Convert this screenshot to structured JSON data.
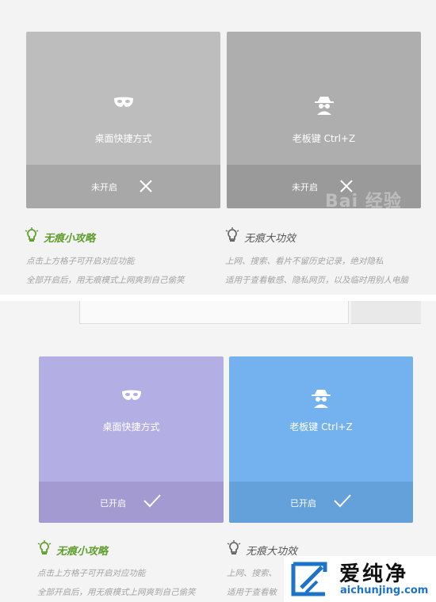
{
  "screen_top": {
    "cards": [
      {
        "id": "desktop",
        "title": "桌面快捷方式",
        "status": "未开启",
        "icon": "mask-icon",
        "action_icon": "close-icon",
        "face_color": "#bdbdbd",
        "foot_color": "#a8a8a8"
      },
      {
        "id": "boss",
        "title": "老板键 Ctrl+Z",
        "status": "未开启",
        "icon": "incognito-person-icon",
        "action_icon": "close-icon",
        "face_color": "#aeaeae",
        "foot_color": "#9a9a9a"
      }
    ],
    "tips_left": {
      "heading": "无痕小攻略",
      "lines": [
        "点击上方格子可开启对应功能",
        "全部开启后，用无痕模式上网爽到自己偷笑"
      ],
      "color": "#5e9e2a"
    },
    "tips_right": {
      "heading": "无痕大功效",
      "lines": [
        "上网、搜索、看片不留历史记录，绝对隐私",
        "适用于查看敏感、隐私网页，以及临时用别人电脑"
      ],
      "color": "#555555"
    },
    "watermark": "Bai 经验"
  },
  "screen_bottom": {
    "cards": [
      {
        "id": "desktop",
        "title": "桌面快捷方式",
        "status": "已开启",
        "icon": "mask-icon",
        "action_icon": "check-icon",
        "face_color": "#b3aee3",
        "foot_color": "#a29ad1"
      },
      {
        "id": "boss",
        "title": "老板键 Ctrl+Z",
        "status": "已开启",
        "icon": "incognito-person-icon",
        "action_icon": "check-icon",
        "face_color": "#74b2ef",
        "foot_color": "#64a1da"
      }
    ],
    "tips_left": {
      "heading": "无痕小攻略",
      "lines": [
        "点击上方格子可开启对应功能",
        "全部开启后，用无痕模式上网爽到自己偷笑"
      ],
      "color": "#5e9e2a"
    },
    "tips_right": {
      "heading": "无痕大功效",
      "lines": [
        "上网、搜索、",
        "适用于查看敏"
      ],
      "color": "#555555"
    }
  },
  "site_logo": {
    "name": "爱纯净",
    "domain": "aichunjing.com"
  }
}
